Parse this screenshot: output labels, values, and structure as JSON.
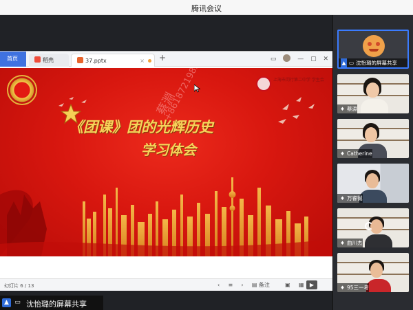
{
  "app": {
    "title": "腾讯会议"
  },
  "office": {
    "home_tab": "首页",
    "dao_tab": "稻壳",
    "file_tab": "37.pptx",
    "close": "×"
  },
  "slide": {
    "title": "《团课》团的光辉历史",
    "subtitle": "学习体会",
    "watermark_name": "蔡淵",
    "watermark_phone": "+8618721985993",
    "school_name": "上海市闵行第二中学 学生会"
  },
  "status": {
    "page": "幻灯片 6 / 13",
    "notes": "备注"
  },
  "presenter_bar": {
    "label": "沈怡璐的屏幕共享"
  },
  "participants": [
    {
      "name": "沈怡璐的屏幕共享",
      "kind": "avatar",
      "active": true
    },
    {
      "name": "蔡淵",
      "kind": "video"
    },
    {
      "name": "Catherine",
      "kind": "video"
    },
    {
      "name": "万睿铖",
      "kind": "video"
    },
    {
      "name": "曲川杰",
      "kind": "video"
    },
    {
      "name": "95三一考",
      "kind": "video"
    }
  ],
  "colors": {
    "accent": "#3b7cff",
    "slide_red": "#d8170f",
    "gold": "#f7d35a"
  }
}
